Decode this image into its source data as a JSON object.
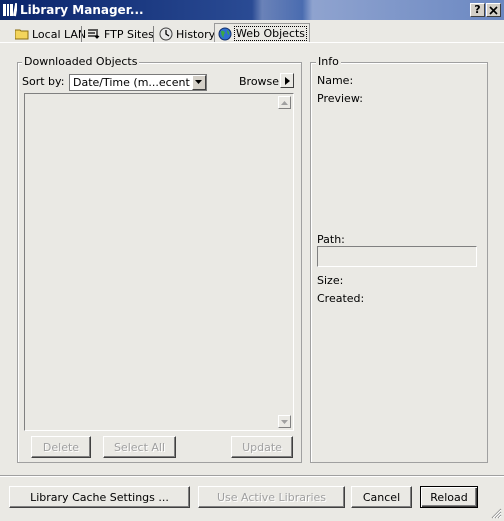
{
  "window": {
    "title": "Library Manager...",
    "help_button": "?",
    "close_button": "X"
  },
  "tabs": [
    {
      "label": "Local LAN",
      "icon": "folder-icon"
    },
    {
      "label": "FTP Sites",
      "icon": "ftp-icon"
    },
    {
      "label": "History",
      "icon": "history-icon"
    },
    {
      "label": "Web Objects",
      "icon": "globe-icon",
      "selected": true
    }
  ],
  "downloaded": {
    "legend": "Downloaded Objects",
    "sort_label": "Sort by:",
    "sort_value": "Date/Time (m...ecent first)",
    "browse_label": "Browse",
    "delete_label": "Delete",
    "select_all_label": "Select All",
    "update_label": "Update"
  },
  "info": {
    "legend": "Info",
    "name_label": "Name:",
    "preview_label": "Preview:",
    "path_label": "Path:",
    "path_value": "",
    "size_label": "Size:",
    "created_label": "Created:"
  },
  "footer": {
    "cache_settings_label": "Library Cache Settings ...",
    "use_active_label": "Use Active Libraries",
    "cancel_label": "Cancel",
    "reload_label": "Reload"
  },
  "colors": {
    "titlebar_start": "#0a246a",
    "face": "#eae9e4",
    "disabled_text": "#a0a0a0"
  }
}
